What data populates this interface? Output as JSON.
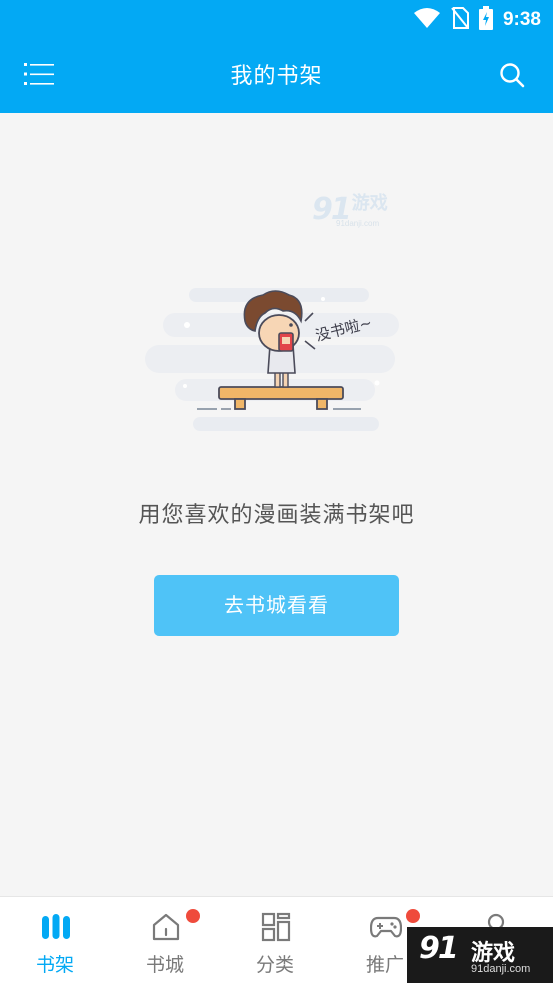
{
  "status_bar": {
    "time": "9:38",
    "icons": [
      "wifi-icon",
      "no-sim-icon",
      "battery-charging-icon"
    ]
  },
  "header": {
    "title": "我的书架",
    "left_icon": "menu-icon",
    "right_icon": "search-icon"
  },
  "watermark_top": {
    "number": "91",
    "text": "游戏",
    "url": "91danji.com"
  },
  "illustration": {
    "speech_text": "没书啦~"
  },
  "empty_state": {
    "message": "用您喜欢的漫画装满书架吧",
    "button_label": "去书城看看"
  },
  "tabs": [
    {
      "label": "书架",
      "icon": "bookshelf-icon",
      "active": true,
      "badge": false
    },
    {
      "label": "书城",
      "icon": "home-icon",
      "active": false,
      "badge": true
    },
    {
      "label": "分类",
      "icon": "category-grid-icon",
      "active": false,
      "badge": false
    },
    {
      "label": "推广",
      "icon": "gamepad-icon",
      "active": false,
      "badge": true
    },
    {
      "label": "",
      "icon": "profile-icon",
      "active": false,
      "badge": false
    }
  ],
  "watermark_corner": {
    "number": "91",
    "text": "游戏",
    "url": "91danji.com"
  },
  "colors": {
    "primary": "#03a9f4",
    "button": "#4fc3f7",
    "badge": "#ef4b3c",
    "background": "#f5f5f5"
  }
}
